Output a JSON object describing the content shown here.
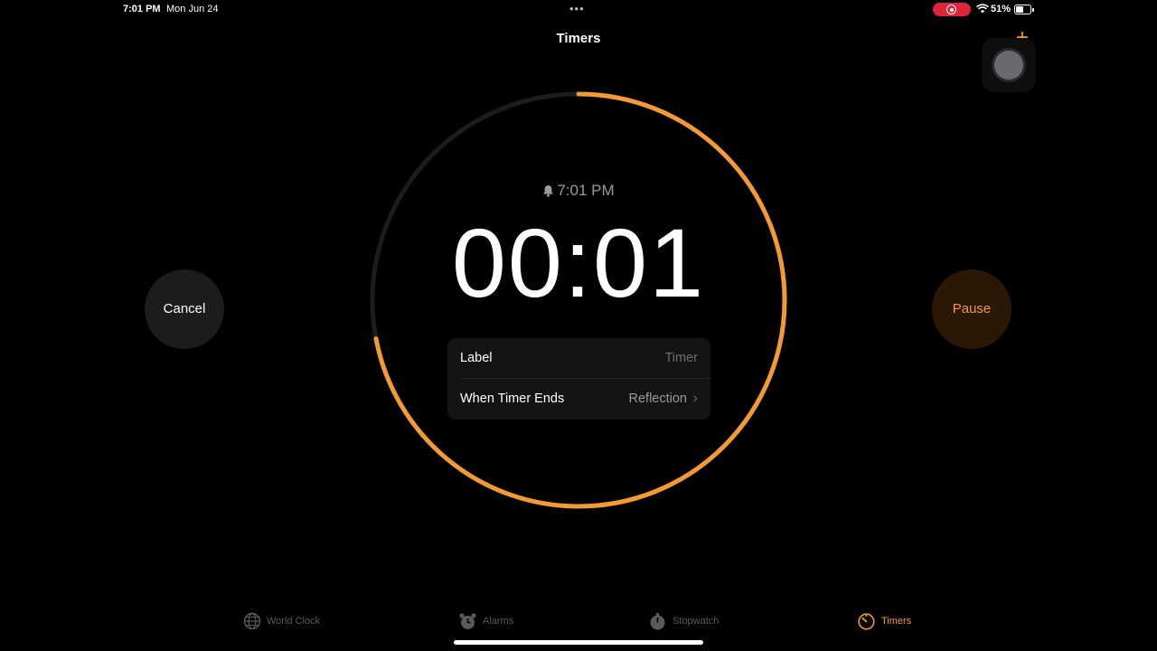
{
  "status_bar": {
    "time": "7:01 PM",
    "date": "Mon Jun 24",
    "multitask_dots": "•••",
    "battery_pct": "51%",
    "recording_color": "#e0243a"
  },
  "header": {
    "title": "Timers",
    "add_symbol": "+"
  },
  "timer": {
    "alarm_time": "7:01 PM",
    "remaining": "00:01",
    "progress_remaining": 0.72,
    "ring_color": "#f49a32",
    "track_color": "#1c1c1e"
  },
  "options": {
    "label": {
      "name": "Label",
      "value": "Timer"
    },
    "when_ends": {
      "name": "When Timer Ends",
      "value": "Reflection"
    }
  },
  "buttons": {
    "cancel": "Cancel",
    "pause": "Pause"
  },
  "tabs": [
    {
      "label": "World Clock",
      "icon": "globe-icon"
    },
    {
      "label": "Alarms",
      "icon": "alarm-clock-icon"
    },
    {
      "label": "Stopwatch",
      "icon": "stopwatch-icon"
    },
    {
      "label": "Timers",
      "icon": "timer-icon",
      "active": true
    }
  ],
  "accent_color": "#f49a32"
}
